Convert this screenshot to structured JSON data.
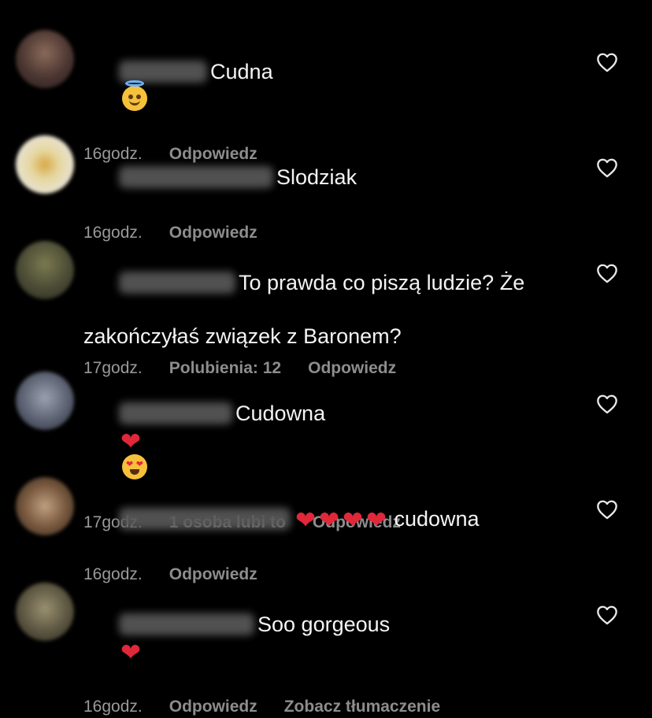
{
  "icons": {
    "like": "heart-outline-icon"
  },
  "colors": {
    "background": "#000000",
    "text": "#f4f4f4",
    "meta": "#9a9a9a",
    "heart": "#e0283a"
  },
  "comments": [
    {
      "text": "Cudna",
      "emoji_after": [
        "smiling-face-with-halo"
      ],
      "time": "16godz.",
      "likes_text": "",
      "reply": "Odpowiedz",
      "translate": ""
    },
    {
      "text": "Slodziak",
      "time": "16godz.",
      "likes_text": "",
      "reply": "Odpowiedz",
      "translate": ""
    },
    {
      "text": "To prawda co piszą ludzie? Że",
      "text_line2": "zakończyłaś związek z Baronem?",
      "time": "17godz.",
      "likes_text": "Polubienia: 12",
      "reply": "Odpowiedz",
      "translate": ""
    },
    {
      "text": "Cudowna",
      "emoji_after": [
        "red-heart",
        "heart-eyes"
      ],
      "time": "17godz.",
      "likes_text": "1 osoba lubi to",
      "reply": "Odpowiedz",
      "translate": ""
    },
    {
      "text": "cudowna",
      "emoji_before": [
        "red-heart",
        "red-heart",
        "red-heart",
        "red-heart"
      ],
      "time": "16godz.",
      "likes_text": "",
      "reply": "Odpowiedz",
      "translate": ""
    },
    {
      "text": "Soo gorgeous",
      "emoji_after": [
        "red-heart"
      ],
      "time": "16godz.",
      "likes_text": "",
      "reply": "Odpowiedz",
      "translate": "Zobacz tłumaczenie"
    }
  ]
}
